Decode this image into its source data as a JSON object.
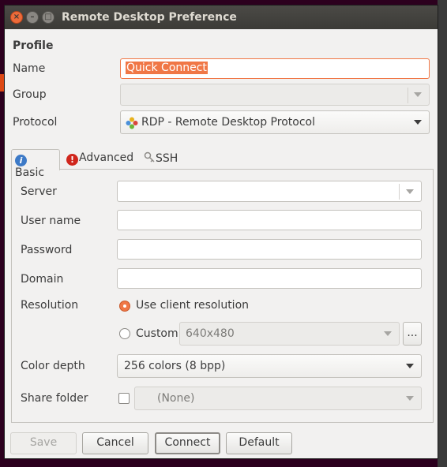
{
  "window": {
    "title": "Remote Desktop Preference"
  },
  "profile": {
    "heading": "Profile",
    "name_label": "Name",
    "name_value": "Quick Connect",
    "group_label": "Group",
    "group_value": "",
    "protocol_label": "Protocol",
    "protocol_value": "RDP - Remote Desktop Protocol"
  },
  "tabs": [
    {
      "label": "Basic",
      "icon": "info-icon"
    },
    {
      "label": "Advanced",
      "icon": "warning-icon"
    },
    {
      "label": "SSH",
      "icon": "key-icon"
    }
  ],
  "basic": {
    "server_label": "Server",
    "server_value": "",
    "username_label": "User name",
    "username_value": "",
    "password_label": "Password",
    "password_value": "",
    "domain_label": "Domain",
    "domain_value": "",
    "resolution_label": "Resolution",
    "resolution_option_client": "Use client resolution",
    "resolution_option_custom": "Custom",
    "custom_resolution_value": "640x480",
    "custom_more_label": "...",
    "colordepth_label": "Color depth",
    "colordepth_value": "256 colors (8 bpp)",
    "sharefolder_label": "Share folder",
    "sharefolder_value": "(None)"
  },
  "buttons": {
    "save": "Save",
    "cancel": "Cancel",
    "connect": "Connect",
    "default": "Default"
  },
  "colors": {
    "accent": "#f07746",
    "titlebar": "#3c3b37"
  }
}
